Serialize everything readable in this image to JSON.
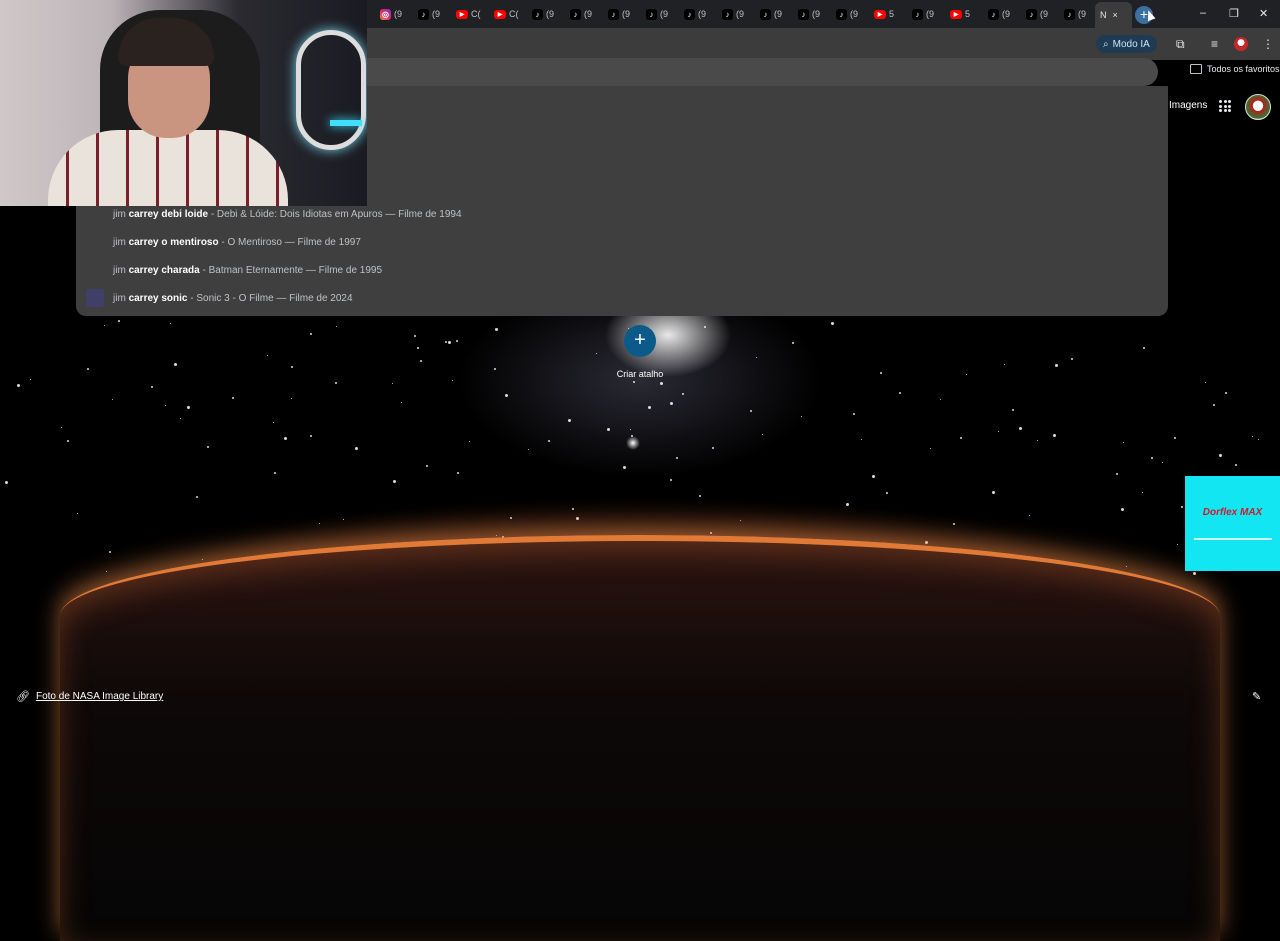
{
  "browser": {
    "tabs": [
      {
        "icon": "instagram-icon",
        "kind": "ig",
        "label": "(9"
      },
      {
        "icon": "tiktok-icon",
        "kind": "tiktok",
        "label": "(9"
      },
      {
        "icon": "youtube-icon",
        "kind": "yt",
        "label": "C("
      },
      {
        "icon": "youtube-icon",
        "kind": "yt",
        "label": "C("
      },
      {
        "icon": "tiktok-icon",
        "kind": "tiktok",
        "label": "(9"
      },
      {
        "icon": "tiktok-icon",
        "kind": "tiktok",
        "label": "(9"
      },
      {
        "icon": "tiktok-icon",
        "kind": "tiktok",
        "label": "(9"
      },
      {
        "icon": "tiktok-icon",
        "kind": "tiktok",
        "label": "(9"
      },
      {
        "icon": "tiktok-icon",
        "kind": "tiktok",
        "label": "(9"
      },
      {
        "icon": "tiktok-icon",
        "kind": "tiktok",
        "label": "(9"
      },
      {
        "icon": "tiktok-icon",
        "kind": "tiktok",
        "label": "(9"
      },
      {
        "icon": "tiktok-icon",
        "kind": "tiktok",
        "label": "(9"
      },
      {
        "icon": "tiktok-icon",
        "kind": "tiktok",
        "label": "(9"
      },
      {
        "icon": "youtube-icon",
        "kind": "yt",
        "label": "5"
      },
      {
        "icon": "tiktok-icon",
        "kind": "tiktok",
        "label": "(9"
      },
      {
        "icon": "youtube-icon",
        "kind": "yt",
        "label": "5"
      },
      {
        "icon": "tiktok-icon",
        "kind": "tiktok",
        "label": "(9"
      },
      {
        "icon": "tiktok-icon",
        "kind": "tiktok",
        "label": "(9"
      },
      {
        "icon": "tiktok-icon",
        "kind": "tiktok",
        "label": "(9"
      }
    ],
    "active_tab": {
      "label": "N",
      "close": "×"
    },
    "new_tab": "+",
    "window_controls": {
      "minimize": "–",
      "restore": "❐",
      "close": "✕"
    },
    "toolbar": {
      "ai_mode_label": "Modo IA"
    },
    "bookmarks_label": "Todos os favoritos"
  },
  "suggestions": [
    {
      "query_prefix": "jim ",
      "query_bold": "carrey debi loide",
      "detail": " - Debi & Lóide: Dois Idiotas em Apuros — Filme de 1994",
      "thumb": false
    },
    {
      "query_prefix": "jim ",
      "query_bold": "carrey o mentiroso",
      "detail": " - O Mentiroso — Filme de 1997",
      "thumb": false
    },
    {
      "query_prefix": "jim ",
      "query_bold": "carrey charada",
      "detail": " - Batman Eternamente — Filme de 1995",
      "thumb": false
    },
    {
      "query_prefix": "jim ",
      "query_bold": "carrey sonic",
      "detail": " - Sonic 3 - O Filme — Filme de 2024",
      "thumb": true
    }
  ],
  "page": {
    "images_link": "Imagens",
    "shortcut_label": "Criar atalho",
    "shortcut_symbol": "+",
    "background_credit": "Foto de NASA Image Library"
  },
  "ad": {
    "brand": "Dorflex MAX",
    "bg_color": "#12e6f2"
  },
  "colors": {
    "accent": "#0c5a8a",
    "ai_mode_bg": "#1f3a52"
  }
}
